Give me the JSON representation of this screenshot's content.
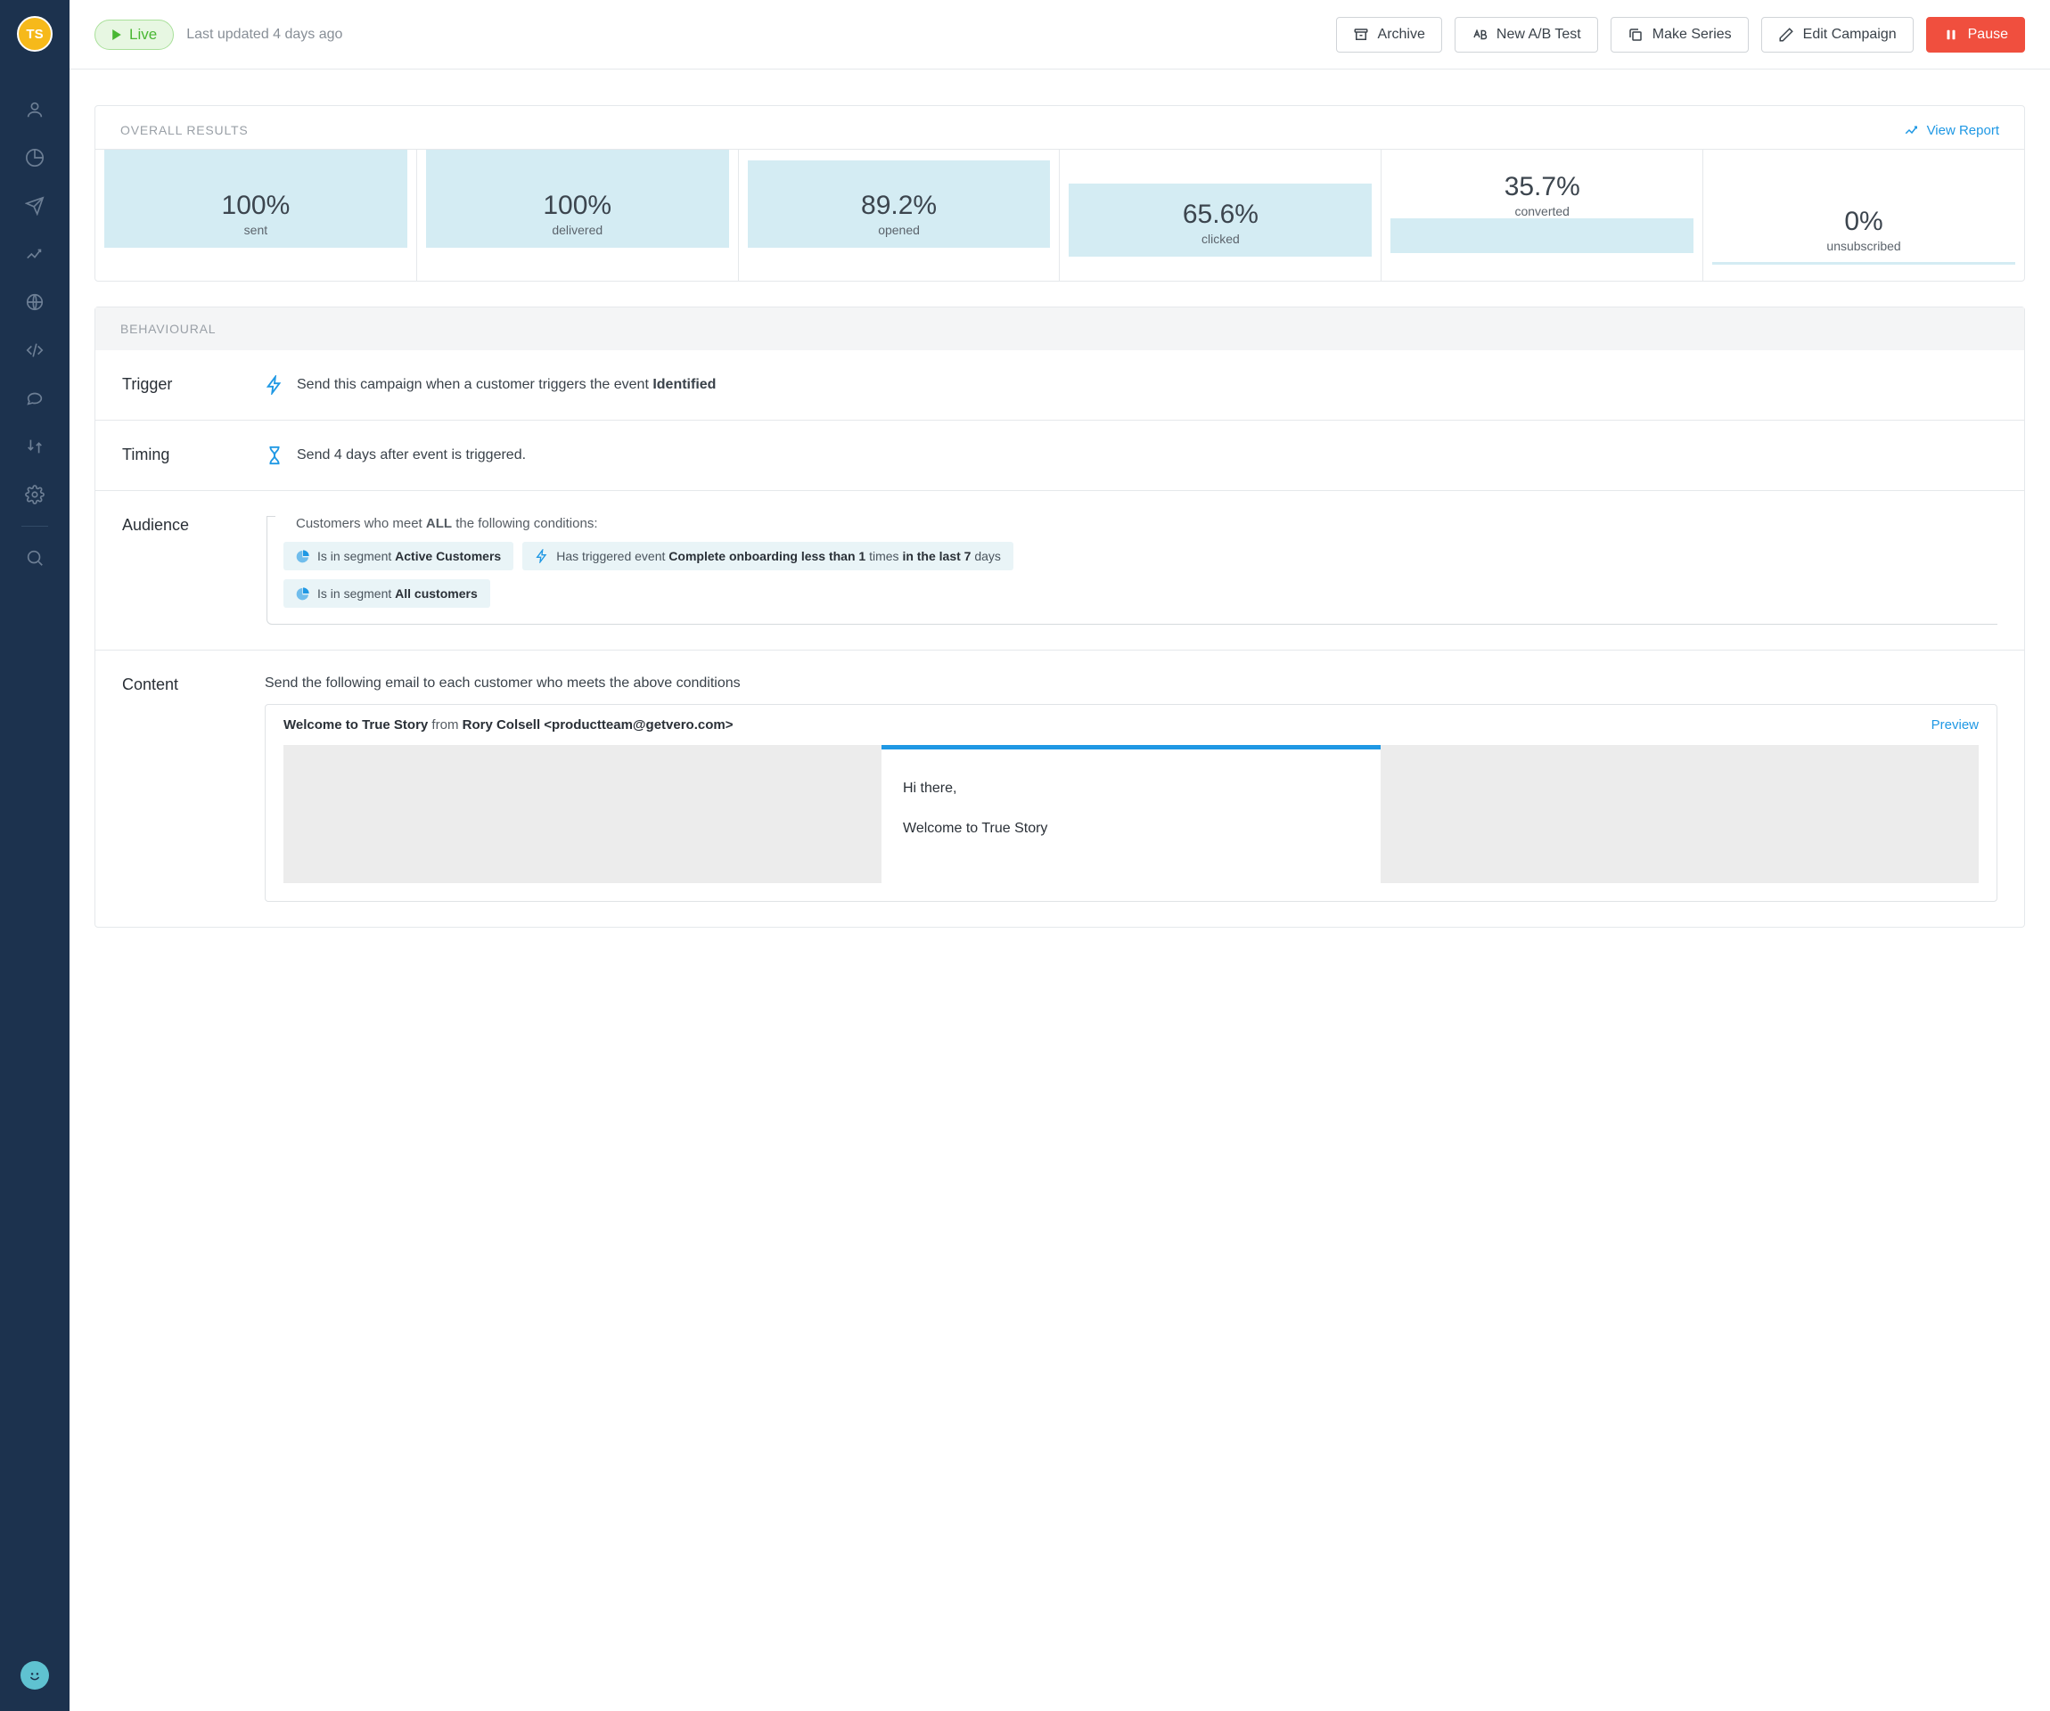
{
  "avatar": {
    "initials": "TS"
  },
  "header": {
    "status": "Live",
    "lastUpdated": "Last updated 4 days ago",
    "buttons": {
      "archive": "Archive",
      "abtest": "New A/B Test",
      "series": "Make Series",
      "edit": "Edit Campaign",
      "pause": "Pause"
    }
  },
  "results": {
    "title": "OVERALL RESULTS",
    "viewReport": "View Report",
    "metrics": [
      {
        "value": "100%",
        "label": "sent",
        "fill": 100
      },
      {
        "value": "100%",
        "label": "delivered",
        "fill": 100
      },
      {
        "value": "89.2%",
        "label": "opened",
        "fill": 89.2
      },
      {
        "value": "65.6%",
        "label": "clicked",
        "fill": 65.6
      },
      {
        "value": "35.7%",
        "label": "converted",
        "fill": 35.7
      },
      {
        "value": "0%",
        "label": "unsubscribed",
        "fill": 0
      }
    ]
  },
  "behavioural": {
    "title": "BEHAVIOURAL",
    "trigger": {
      "label": "Trigger",
      "prefix": "Send this campaign when a customer triggers the event ",
      "event": "Identified"
    },
    "timing": {
      "label": "Timing",
      "text": "Send 4 days after event is triggered."
    },
    "audience": {
      "label": "Audience",
      "introPrefix": "Customers who meet ",
      "introBold": "ALL",
      "introSuffix": " the following conditions:",
      "conditions": {
        "c1_pre": "Is in segment ",
        "c1_bold": "Active Customers",
        "c2_pre": "Has triggered event ",
        "c2_b1": "Complete onboarding less than 1",
        "c2_mid": " times ",
        "c2_b2": "in the last 7",
        "c2_suf": " days",
        "c3_pre": "Is in segment ",
        "c3_bold": "All customers"
      }
    },
    "contentSection": {
      "label": "Content",
      "intro": "Send the following email to each customer who meets the above conditions",
      "subject": "Welcome to True Story",
      "fromWord": " from ",
      "fromName": "Rory Colsell <productteam@getvero.com>",
      "preview": "Preview",
      "body": {
        "greeting": "Hi there,",
        "line1": "Welcome to True Story"
      }
    }
  }
}
